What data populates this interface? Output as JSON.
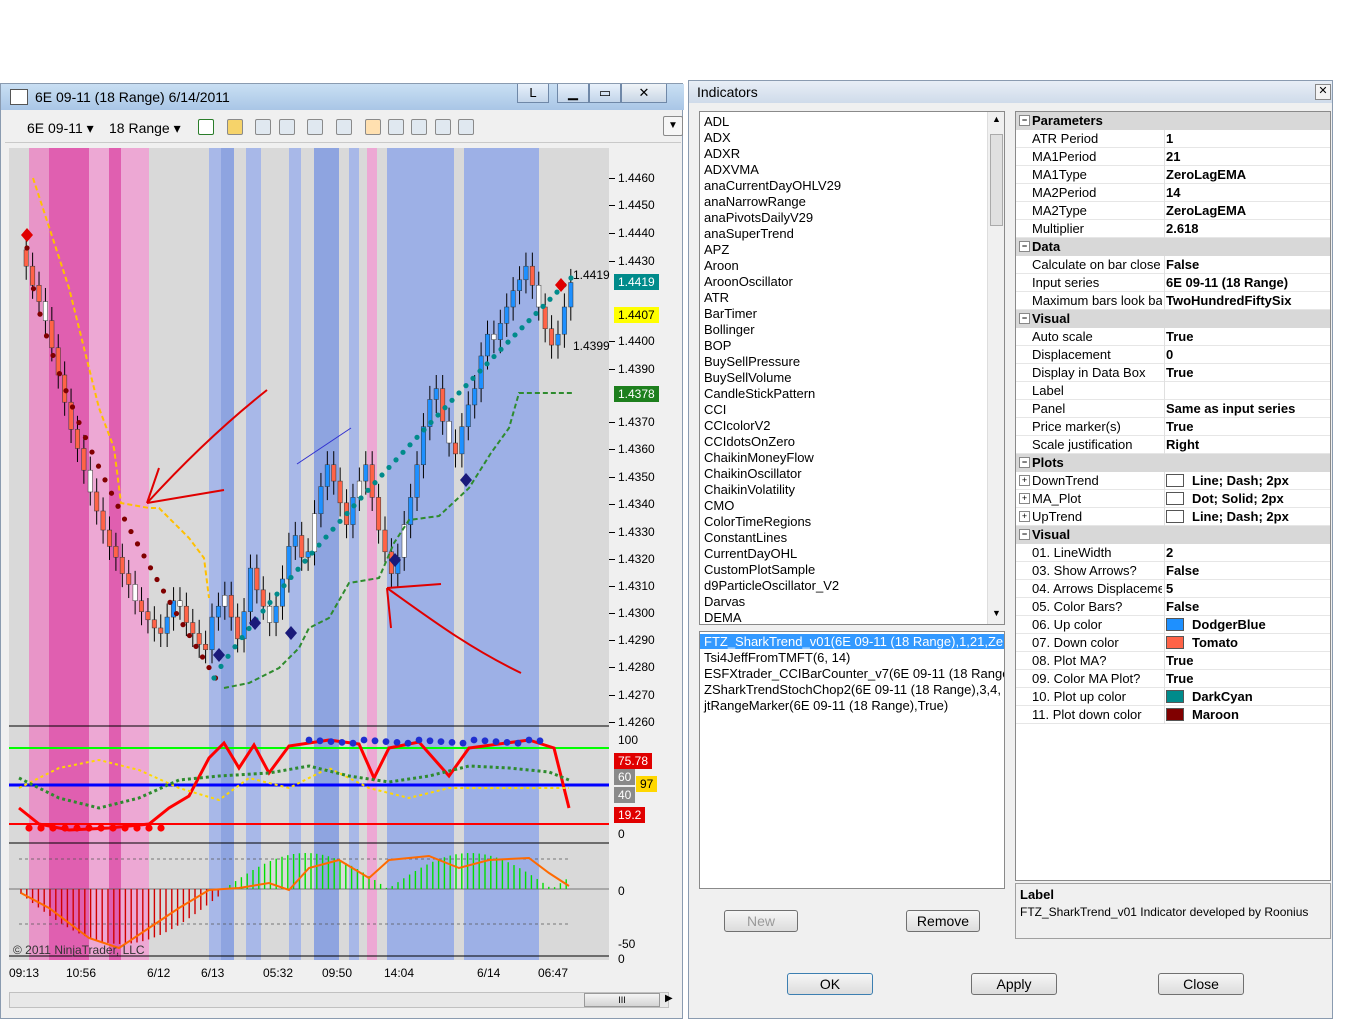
{
  "chart_window": {
    "title": "6E 09-11 (18 Range)  6/14/2011",
    "btn_l": "L",
    "instrument": "6E 09-11",
    "interval": "18 Range",
    "price_labels": [
      "1.4460",
      "1.4450",
      "1.4440",
      "1.4430",
      "1.4400",
      "1.4390",
      "1.4370",
      "1.4360",
      "1.4350",
      "1.4340",
      "1.4330",
      "1.4320",
      "1.4310",
      "1.4300",
      "1.4290",
      "1.4280",
      "1.4270",
      "1.4260"
    ],
    "flags": {
      "last": "1.4419",
      "yellow": "1.4407",
      "green": "1.4378",
      "hi": "1.4419",
      "lo": "1.4399"
    },
    "osc_labels": [
      "100",
      "0"
    ],
    "osc_flags": {
      "red_top": "75.78",
      "box60": "60",
      "yellow": "97",
      "box40": "40",
      "red_bottom": "19.2"
    },
    "hist_labels": [
      "0",
      "-50",
      "0"
    ],
    "time_labels": [
      "09:13",
      "10:56",
      "6/12",
      "6/13",
      "05:32",
      "09:50",
      "14:04",
      "6/14",
      "06:47"
    ],
    "copyright": "© 2011 NinjaTrader, LLC",
    "scroll_thumb": "III",
    "colors": {
      "up": "#1e90ff",
      "down": "#ff6347",
      "up_line": "#008b8b",
      "down_line": "#800000"
    }
  },
  "indicators_window": {
    "title": "Indicators",
    "available": [
      "ADL",
      "ADX",
      "ADXR",
      "ADXVMA",
      "anaCurrentDayOHLV29",
      "anaNarrowRange",
      "anaPivotsDailyV29",
      "anaSuperTrend",
      "APZ",
      "Aroon",
      "AroonOscillator",
      "ATR",
      "BarTimer",
      "Bollinger",
      "BOP",
      "BuySellPressure",
      "BuySellVolume",
      "CandleStickPattern",
      "CCI",
      "CCIcolorV2",
      "CCIdotsOnZero",
      "ChaikinMoneyFlow",
      "ChaikinOscillator",
      "ChaikinVolatility",
      "CMO",
      "ColorTimeRegions",
      "ConstantLines",
      "CurrentDayOHL",
      "CustomPlotSample",
      "d9ParticleOscillator_V2",
      "Darvas",
      "DEMA"
    ],
    "applied": [
      "FTZ_SharkTrend_v01(6E 09-11 (18 Range),1,21,Ze",
      "Tsi4JeffFromTMFT(6, 14)",
      "ESFXtrader_CCIBarCounter_v7(6E 09-11 (18 Range",
      "ZSharkTrendStochChop2(6E 09-11 (18 Range),3,4,",
      "jtRangeMarker(6E 09-11 (18 Range),True)"
    ],
    "buttons": {
      "new": "New",
      "remove": "Remove",
      "ok": "OK",
      "apply": "Apply",
      "close": "Close"
    },
    "categories": {
      "parameters": "Parameters",
      "data": "Data",
      "visual": "Visual",
      "plots": "Plots",
      "visual2": "Visual"
    },
    "parameters": [
      {
        "name": "ATR Period",
        "value": "1"
      },
      {
        "name": "MA1Period",
        "value": "21"
      },
      {
        "name": "MA1Type",
        "value": "ZeroLagEMA"
      },
      {
        "name": "MA2Period",
        "value": "14"
      },
      {
        "name": "MA2Type",
        "value": "ZeroLagEMA"
      },
      {
        "name": "Multiplier",
        "value": "2.618"
      }
    ],
    "data": [
      {
        "name": "Calculate on bar close",
        "value": "False"
      },
      {
        "name": "Input series",
        "value": "6E 09-11 (18 Range)"
      },
      {
        "name": "Maximum bars look ba",
        "value": "TwoHundredFiftySix"
      }
    ],
    "visual": [
      {
        "name": "Auto scale",
        "value": "True"
      },
      {
        "name": "Displacement",
        "value": "0"
      },
      {
        "name": "Display in Data Box",
        "value": "True"
      },
      {
        "name": "Label",
        "value": ""
      },
      {
        "name": "Panel",
        "value": "Same as input series"
      },
      {
        "name": "Price marker(s)",
        "value": "True"
      },
      {
        "name": "Scale justification",
        "value": "Right"
      }
    ],
    "plots": [
      {
        "name": "DownTrend",
        "value": "Line; Dash; 2px"
      },
      {
        "name": "MA_Plot",
        "value": "Dot; Solid; 2px"
      },
      {
        "name": "UpTrend",
        "value": "Line; Dash; 2px"
      }
    ],
    "visual2": [
      {
        "name": "01. LineWidth",
        "value": "2"
      },
      {
        "name": "03. Show Arrows?",
        "value": "False"
      },
      {
        "name": "04. Arrows Displaceme",
        "value": "5"
      },
      {
        "name": "05. Color Bars?",
        "value": "False"
      },
      {
        "name": "06. Up color",
        "value": "DodgerBlue",
        "color": "#1e90ff"
      },
      {
        "name": "07. Down color",
        "value": "Tomato",
        "color": "#ff6347"
      },
      {
        "name": "08. Plot MA?",
        "value": "True"
      },
      {
        "name": "09. Color MA Plot?",
        "value": "True"
      },
      {
        "name": "10. Plot up color",
        "value": "DarkCyan",
        "color": "#008b8b"
      },
      {
        "name": "11. Plot down color",
        "value": "Maroon",
        "color": "#800000"
      }
    ],
    "description": {
      "title": "Label",
      "text": "FTZ_SharkTrend_v01 Indicator developed by Roonius"
    }
  }
}
